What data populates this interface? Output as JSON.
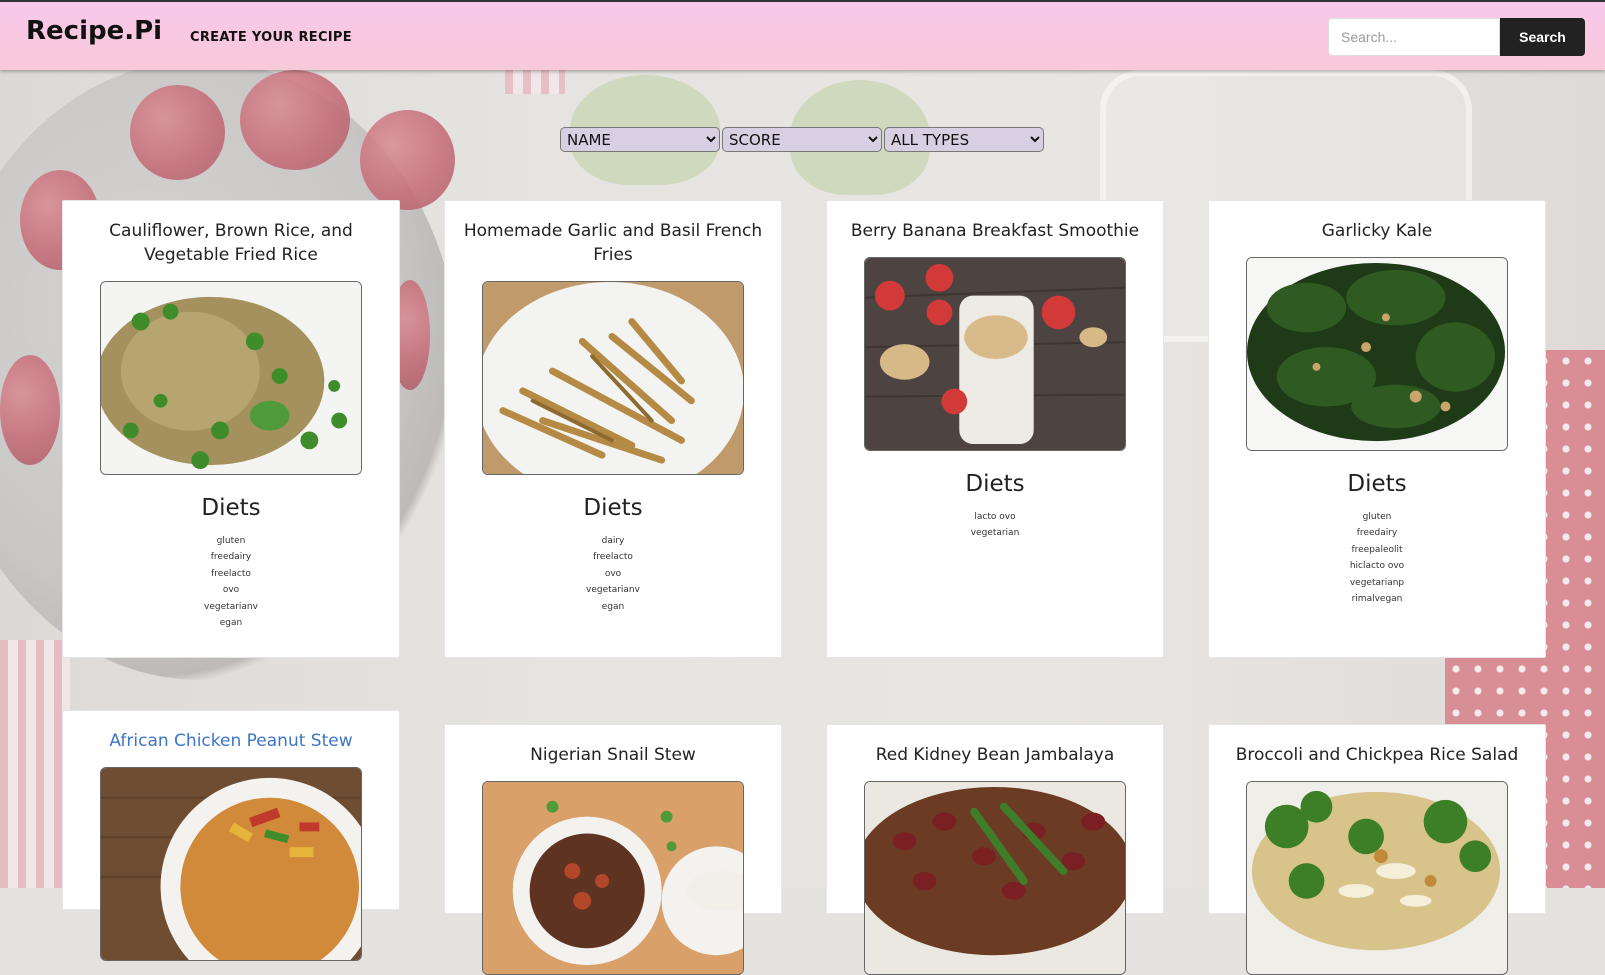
{
  "header": {
    "brand": "Recipe.Pi",
    "nav_link": "CREATE YOUR RECIPE",
    "search_placeholder": "Search...",
    "search_button": "Search"
  },
  "filters": {
    "sort_by": "NAME",
    "order_by": "SCORE",
    "type": "ALL TYPES"
  },
  "recipes": [
    {
      "title": "Cauliflower, Brown Rice, and Vegetable Fried Rice",
      "diets_heading": "Diets",
      "diets": [
        "gluten",
        "freedairy",
        "freelacto",
        "ovo",
        "vegetarianv",
        "egan"
      ]
    },
    {
      "title": "Homemade Garlic and Basil French Fries",
      "diets_heading": "Diets",
      "diets": [
        "dairy",
        "freelacto",
        "ovo",
        "vegetarianv",
        "egan"
      ]
    },
    {
      "title": "Berry Banana Breakfast Smoothie",
      "diets_heading": "Diets",
      "diets": [
        "lacto ovo",
        "vegetarian"
      ]
    },
    {
      "title": "Garlicky Kale",
      "diets_heading": "Diets",
      "diets": [
        "gluten",
        "freedairy",
        "freepaleolit",
        "hiclacto ovo",
        "vegetarianp",
        "rimalvegan"
      ]
    },
    {
      "title": "African Chicken Peanut Stew"
    },
    {
      "title": "Nigerian Snail Stew"
    },
    {
      "title": "Red Kidney Bean Jambalaya"
    },
    {
      "title": "Broccoli and Chickpea Rice Salad"
    }
  ]
}
